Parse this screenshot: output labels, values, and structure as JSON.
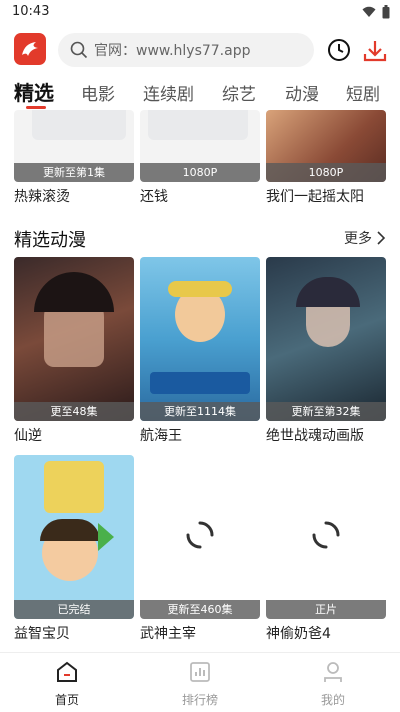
{
  "status_bar": {
    "time": "10:43"
  },
  "search": {
    "text": "官网：www.hlys77.app"
  },
  "tabs": [
    {
      "label": "精选"
    },
    {
      "label": "电影"
    },
    {
      "label": "连续剧"
    },
    {
      "label": "综艺"
    },
    {
      "label": "动漫"
    },
    {
      "label": "短剧"
    }
  ],
  "top_row": [
    {
      "title": "热辣滚烫",
      "badge": "更新至第1集"
    },
    {
      "title": "还钱",
      "badge": "1080P"
    },
    {
      "title": "我们一起摇太阳",
      "badge": "1080P"
    }
  ],
  "anime_section": {
    "title": "精选动漫",
    "more": "更多",
    "items": [
      {
        "title": "仙逆",
        "badge": "更至48集"
      },
      {
        "title": "航海王",
        "badge": "更新至1114集"
      },
      {
        "title": "绝世战魂动画版",
        "badge": "更新至第32集"
      },
      {
        "title": "益智宝贝",
        "badge": "已完结"
      },
      {
        "title": "武神主宰",
        "badge": "更新至460集"
      },
      {
        "title": "神偷奶爸4",
        "badge": "正片"
      }
    ]
  },
  "bottom_nav": [
    {
      "label": "首页"
    },
    {
      "label": "排行榜"
    },
    {
      "label": "我的"
    }
  ],
  "colors": {
    "accent": "#e23a2b"
  }
}
